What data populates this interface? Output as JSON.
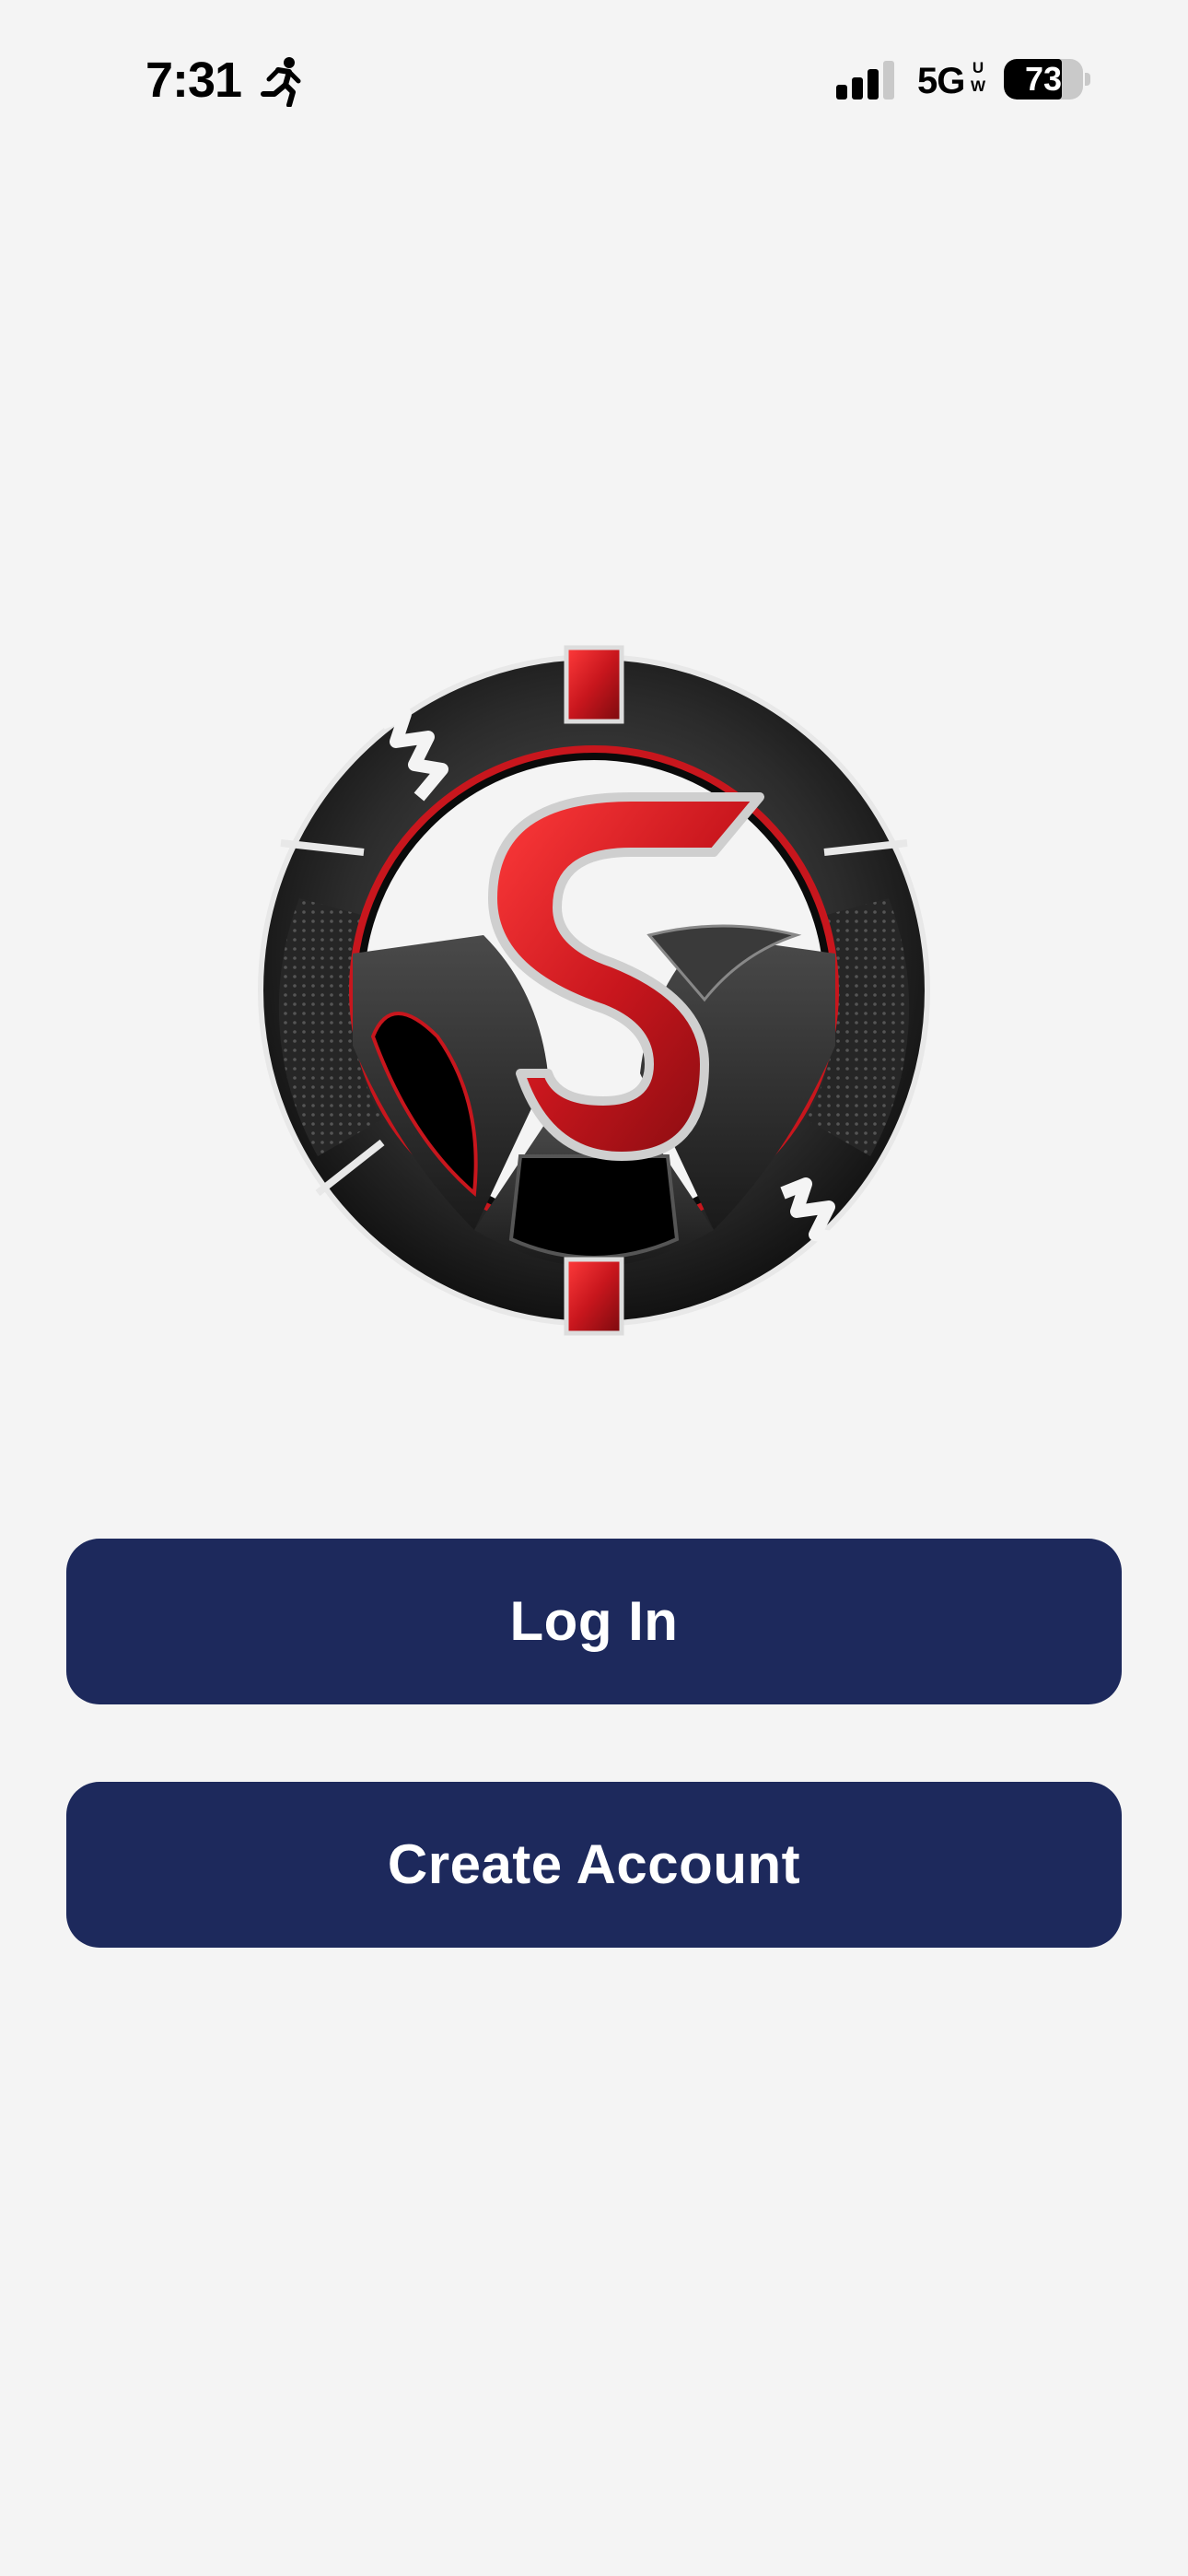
{
  "status_bar": {
    "time": "7:31",
    "activity_icon": "running-figure-icon",
    "signal_icon": "cellular-signal-icon",
    "signal_bars_active": 3,
    "signal_bars_total": 4,
    "network": "5G",
    "network_suffix_top": "U",
    "network_suffix_bottom": "W",
    "battery_percent": "73",
    "battery_level": 0.73
  },
  "logo": {
    "icon": "steering-wheel-s-logo-icon",
    "colors": {
      "rim": "#2a2a2a",
      "accent_red": "#c8161d",
      "chrome": "#d9d9d9"
    }
  },
  "buttons": {
    "login_label": "Log In",
    "create_account_label": "Create Account",
    "color": "#1d295c",
    "text_color": "#ffffff"
  }
}
